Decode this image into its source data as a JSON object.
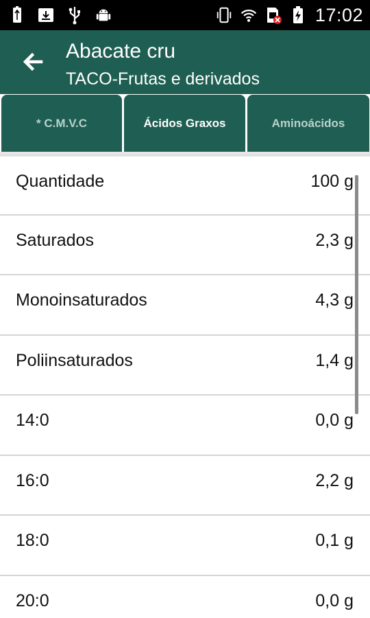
{
  "status_bar": {
    "time": "17:02",
    "left_icons": [
      "usb-battery-icon",
      "download-icon",
      "usb-icon",
      "android-icon"
    ],
    "right_icons": [
      "vibrate-icon",
      "wifi-icon",
      "no-sim-icon",
      "battery-charging-icon"
    ]
  },
  "header": {
    "title": "Abacate cru",
    "subtitle": "TACO-Frutas e derivados",
    "back_icon": "arrow-left-icon"
  },
  "tabs": [
    {
      "label": "* C.M.V.C",
      "active": false
    },
    {
      "label": "Ácidos Graxos",
      "active": true
    },
    {
      "label": "Aminoácidos",
      "active": false
    }
  ],
  "rows": [
    {
      "label": "Quantidade",
      "value": "100 g"
    },
    {
      "label": "Saturados",
      "value": "2,3 g"
    },
    {
      "label": "Monoinsaturados",
      "value": "4,3 g"
    },
    {
      "label": "Poliinsaturados",
      "value": "1,4 g"
    },
    {
      "label": "14:0",
      "value": "0,0 g"
    },
    {
      "label": "16:0",
      "value": "2,2 g"
    },
    {
      "label": "18:0",
      "value": "0,1 g"
    },
    {
      "label": "20:0",
      "value": "0,0 g"
    }
  ],
  "colors": {
    "primary": "#1f5e52",
    "inactive_tab_text": "#b9d3cd",
    "divider": "#d4d4d4"
  }
}
